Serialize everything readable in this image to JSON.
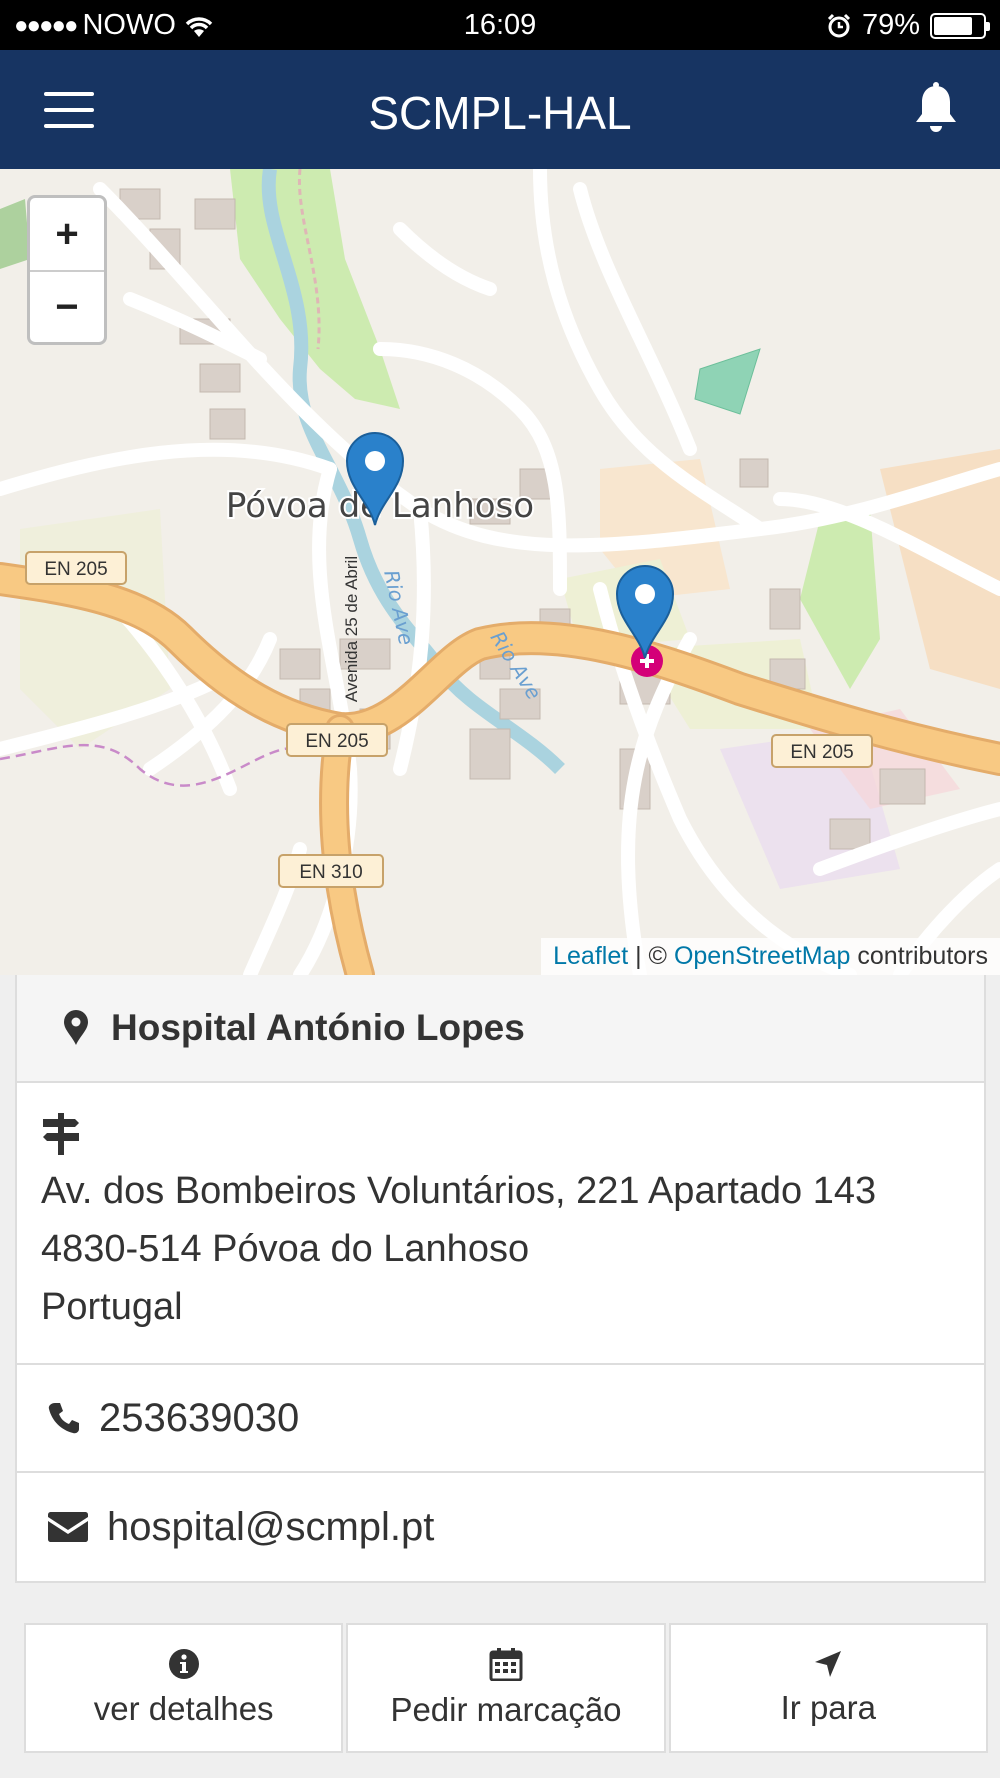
{
  "status_bar": {
    "carrier": "NOWO",
    "time": "16:09",
    "battery": "79%",
    "battery_level": 0.79
  },
  "nav": {
    "title": "SCMPL-HAL",
    "menu_icon": "hamburger-menu-icon",
    "bell_icon": "bell-icon"
  },
  "map": {
    "zoom_in": "+",
    "zoom_out": "−",
    "labels": {
      "town": "Póvoa de Lanhoso",
      "road1": "EN 205",
      "road2": "EN 205",
      "road3": "EN 205",
      "road4": "EN 310",
      "street": "Avenida 25 de Abril",
      "river1": "Rio Ave",
      "river2": "Rio Ave"
    },
    "attribution": {
      "leaflet": "Leaflet",
      "sep": " | © ",
      "osm": "OpenStreetMap",
      "contributors": " contributors"
    },
    "marker_color": "#2a81cb"
  },
  "place": {
    "name": "Hospital António Lopes",
    "address_lines": [
      "Av. dos Bombeiros Voluntários, 221 Apartado 143",
      "4830-514 Póvoa do Lanhoso",
      "Portugal"
    ],
    "phone": "253639030",
    "email": "hospital@scmpl.pt"
  },
  "actions": {
    "details": "ver detalhes",
    "appointment": "Pedir marcação",
    "goto": "Ir para"
  },
  "colors": {
    "navbar": "#173462",
    "link": "#0078a8",
    "major_road": "#f8c983"
  }
}
